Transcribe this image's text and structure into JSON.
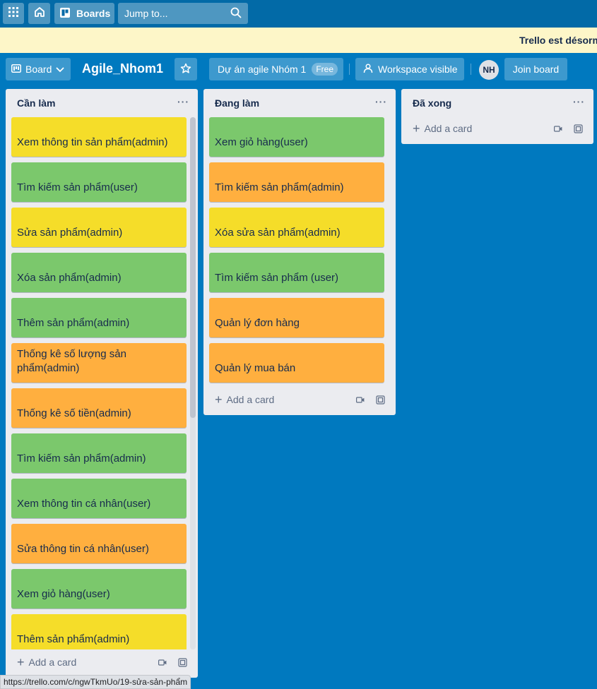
{
  "topnav": {
    "apps_icon": "grid-icon",
    "home_icon": "home-icon",
    "boards_label": "Boards",
    "search_placeholder": "Jump to..."
  },
  "banner": {
    "text": "Trello est désorm"
  },
  "board": {
    "view_label": "Board",
    "title": "Agile_Nhom1",
    "workspace_label": "Dự án agile Nhóm 1",
    "workspace_badge": "Free",
    "visibility_label": "Workspace visible",
    "avatar_initials": "NH",
    "join_label": "Join board"
  },
  "lists": [
    {
      "title": "Cần làm",
      "cards": [
        {
          "title": "Xem thông tin sản phẩm(admin)",
          "color": "#f5dd29"
        },
        {
          "title": "Tìm kiếm sản phẩm(user)",
          "color": "#7bc86c"
        },
        {
          "title": "Sửa sản phẩm(admin)",
          "color": "#f5dd29"
        },
        {
          "title": "Xóa sản phẩm(admin)",
          "color": "#7bc86c"
        },
        {
          "title": "Thêm sản phẩm(admin)",
          "color": "#7bc86c"
        },
        {
          "title": "Thống kê số lượng sản phẩm(admin)",
          "color": "#ffaf3f"
        },
        {
          "title": "Thống kê số tiền(admin)",
          "color": "#ffaf3f"
        },
        {
          "title": "Tìm kiếm sản phẩm(admin)",
          "color": "#7bc86c"
        },
        {
          "title": "Xem thông tin cá nhân(user)",
          "color": "#7bc86c"
        },
        {
          "title": "Sửa thông tin cá nhân(user)",
          "color": "#ffaf3f"
        },
        {
          "title": "Xem giỏ hàng(user)",
          "color": "#7bc86c"
        },
        {
          "title": "Thêm sản phẩm(admin)",
          "color": "#f5dd29"
        }
      ],
      "add_card_label": "Add a card"
    },
    {
      "title": "Đang làm",
      "cards": [
        {
          "title": "Xem giỏ hàng(user)",
          "color": "#7bc86c"
        },
        {
          "title": "Tìm kiếm sản phẩm(admin)",
          "color": "#ffaf3f"
        },
        {
          "title": "Xóa sửa sản phẩm(admin)",
          "color": "#f5dd29"
        },
        {
          "title": "Tìm kiếm sản phẩm (user)",
          "color": "#7bc86c"
        },
        {
          "title": "Quản lý đơn hàng",
          "color": "#ffaf3f"
        },
        {
          "title": "Quản lý mua bán",
          "color": "#ffaf3f"
        }
      ],
      "add_card_label": "Add a card"
    },
    {
      "title": "Đã xong",
      "cards": [],
      "add_card_label": "Add a card"
    }
  ],
  "status_url": "https://trello.com/c/ngwTkmUo/19-sửa-sản-phẩm"
}
